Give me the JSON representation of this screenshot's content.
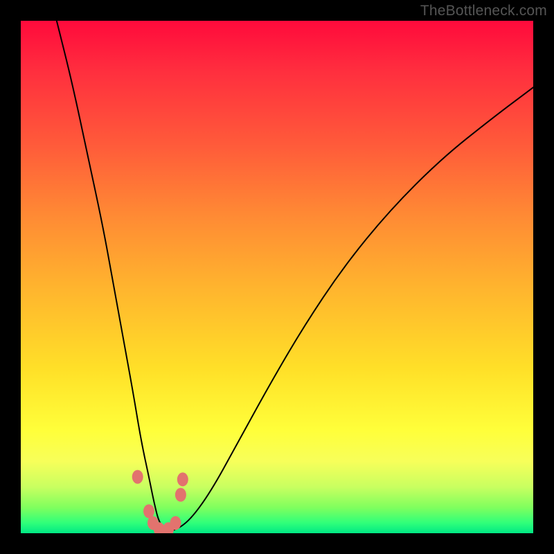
{
  "watermark": "TheBottleneck.com",
  "colors": {
    "curve_stroke": "#000000",
    "marker_fill": "#e2736e",
    "marker_stroke": "#cf5a55",
    "frame": "#000000"
  },
  "chart_data": {
    "type": "line",
    "title": "",
    "xlabel": "",
    "ylabel": "",
    "xlim": [
      0,
      100
    ],
    "ylim": [
      0,
      100
    ],
    "note": "Bottleneck-style V-curve. x is a normalized horizontal parameter (0–100, left→right), y is bottleneck percentage (0 = green bottom, 100 = red top). Values estimated from pixel positions.",
    "series": [
      {
        "name": "bottleneck-curve",
        "x": [
          7,
          10,
          13,
          16,
          18,
          20,
          22,
          23.5,
          25,
          26,
          27,
          28.5,
          30,
          33,
          37,
          42,
          48,
          55,
          63,
          72,
          82,
          92,
          100
        ],
        "y": [
          100,
          88,
          74,
          60,
          49,
          38,
          27,
          18,
          11,
          6,
          2,
          0.5,
          0.5,
          2.5,
          8,
          17,
          28,
          40,
          52,
          63,
          73,
          81,
          87
        ]
      }
    ],
    "markers": {
      "name": "highlight-points",
      "x": [
        22.8,
        25.0,
        25.8,
        27.0,
        28.8,
        30.2,
        31.2,
        31.6
      ],
      "y": [
        11.0,
        4.3,
        2.0,
        0.8,
        0.8,
        2.0,
        7.5,
        10.5
      ]
    }
  }
}
